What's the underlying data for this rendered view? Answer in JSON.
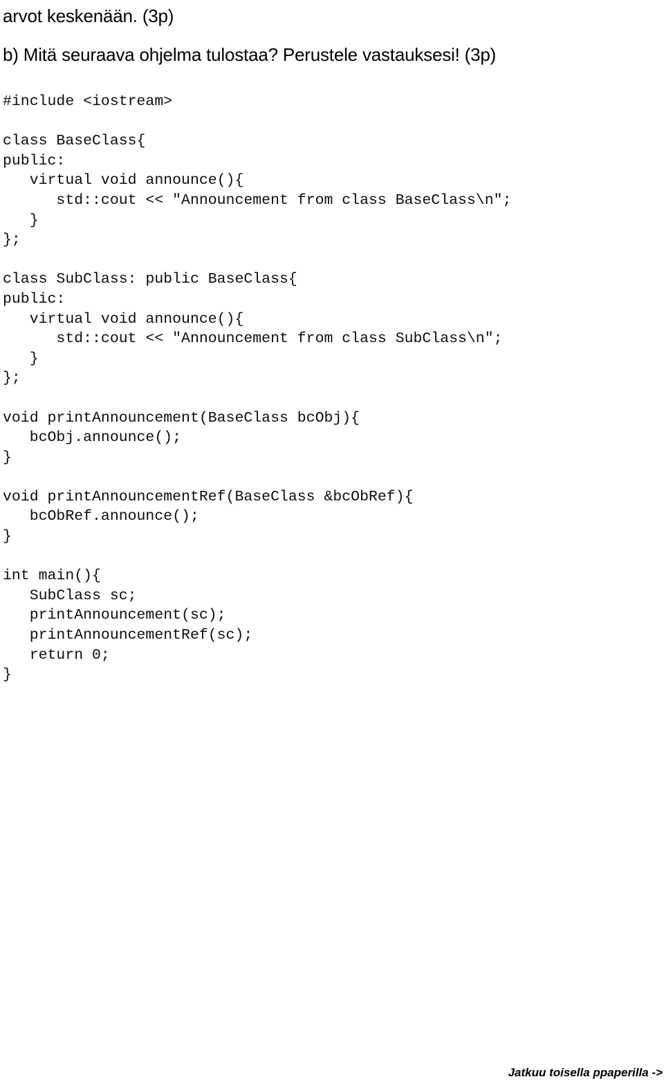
{
  "document": {
    "language": "fi",
    "heading_lines": [
      "arvot keskenään. (3p)",
      "b) Mitä seuraava ohjelma tulostaa? Perustele vastauksesi! (3p)"
    ],
    "code_listing": {
      "language": "cpp",
      "lines": [
        "#include <iostream>",
        "",
        "class BaseClass{",
        "public:",
        "   virtual void announce(){",
        "      std::cout << \"Announcement from class BaseClass\\n\";",
        "   }",
        "};",
        "",
        "class SubClass: public BaseClass{",
        "public:",
        "   virtual void announce(){",
        "      std::cout << \"Announcement from class SubClass\\n\";",
        "   }",
        "};",
        "",
        "void printAnnouncement(BaseClass bcObj){",
        "   bcObj.announce();",
        "}",
        "",
        "void printAnnouncementRef(BaseClass &bcObRef){",
        "   bcObRef.announce();",
        "}",
        "",
        "int main(){",
        "   SubClass sc;",
        "   printAnnouncement(sc);",
        "   printAnnouncementRef(sc);",
        "   return 0;",
        "}"
      ]
    },
    "footer_note": "Jatkuu toisella ppaperilla ->"
  }
}
